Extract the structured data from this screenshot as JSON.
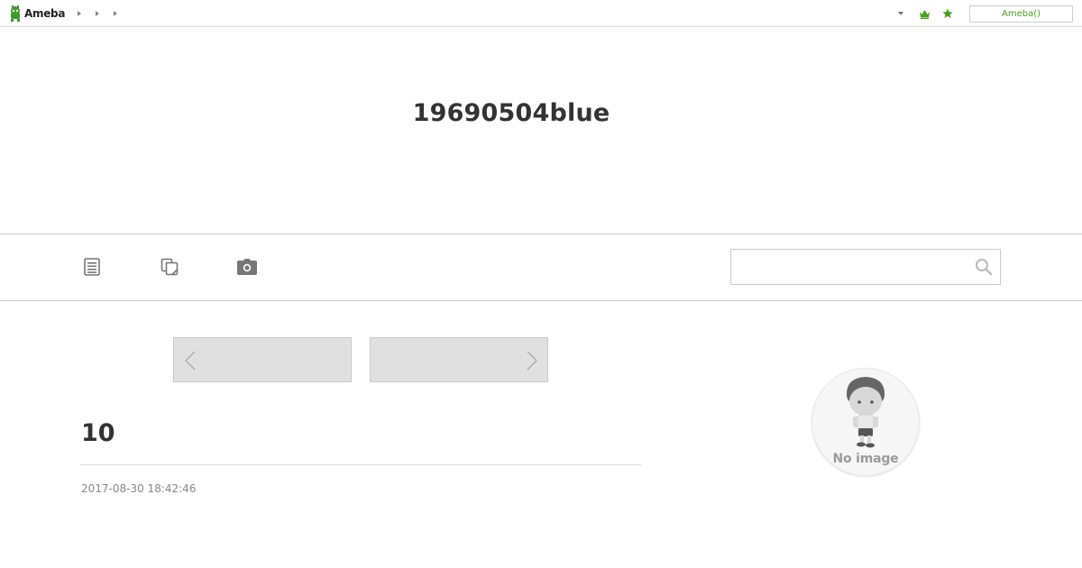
{
  "header": {
    "logo_text": "Ameba",
    "breadcrumb_arrows": 3,
    "ameba_button_label": "Ameba()",
    "icons": [
      "dropdown-caret",
      "crown-icon",
      "star-icon"
    ],
    "accent_color": "#4aa01e"
  },
  "blog": {
    "title": "19690504blue"
  },
  "nav": {
    "icons": [
      "entries-list-icon",
      "themes-icon",
      "camera-icon"
    ],
    "search_placeholder": "",
    "search_value": ""
  },
  "pager": {
    "prev_label": "",
    "next_label": ""
  },
  "entry": {
    "title": "10",
    "date": "2017-08-30 18:42:46"
  },
  "profile": {
    "avatar_text": "No image"
  }
}
